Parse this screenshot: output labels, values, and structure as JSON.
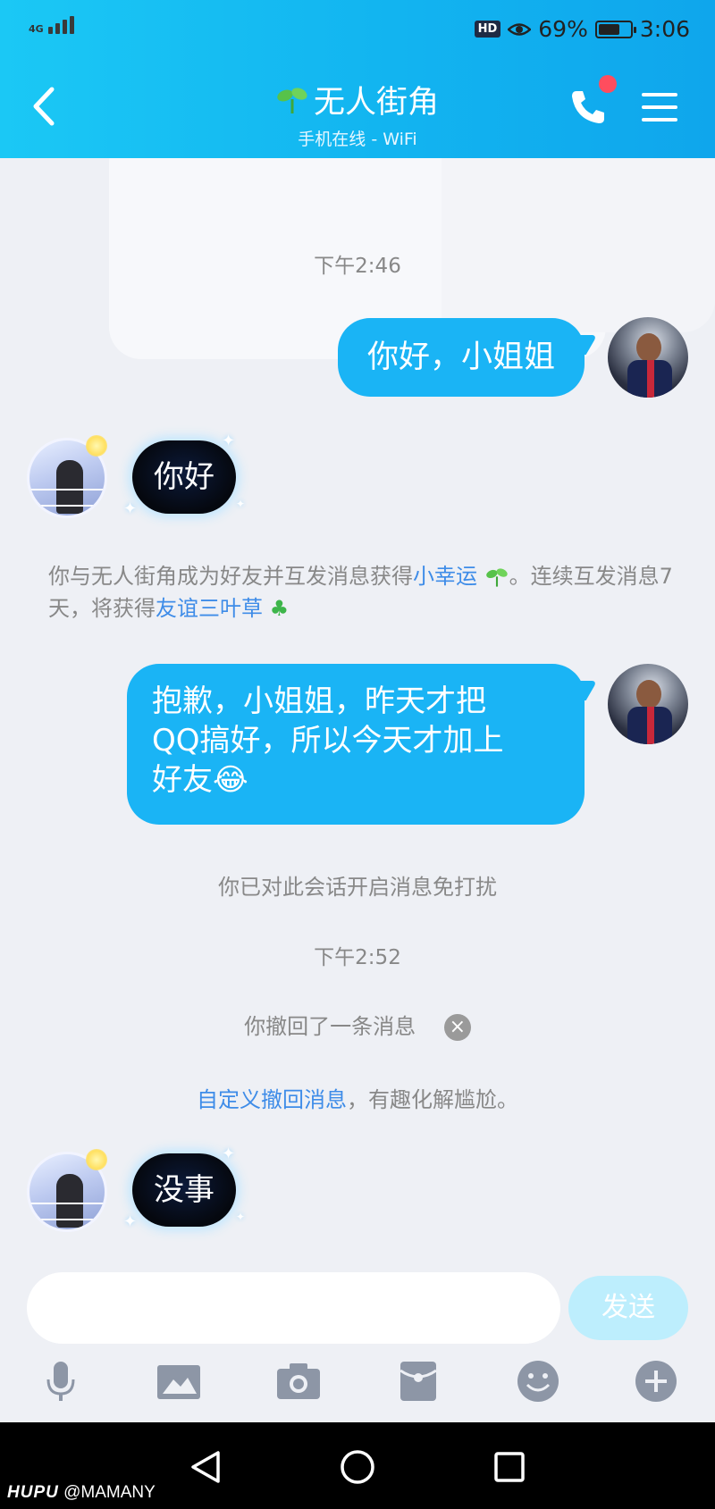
{
  "status_bar": {
    "network": "4G",
    "hd_badge": "HD",
    "battery": "69%",
    "battery_level": 0.69,
    "time": "3:06"
  },
  "header": {
    "title": "无人街角",
    "subtitle": "手机在线 - WiFi",
    "accent_color": "#12b4f0",
    "notification_dot_color": "#ff4d5e"
  },
  "messages": {
    "ts1": "下午2:46",
    "me_msg1": "你好，小姐姐",
    "her_sticker1": "你好",
    "sys1_part1": "你与无人街角成为好友并互发消息获得",
    "sys1_link1": "小幸运",
    "sys1_part2": "。连续互发消息7天，将获得",
    "sys1_link2": "友谊三叶草",
    "me_msg2_line1": "抱歉，小姐姐，昨天才把",
    "me_msg2_line2": "QQ搞好，所以今天才加上",
    "me_msg2_line3": "好友",
    "me_msg2_emoji": "😂",
    "mute_note": "你已对此会话开启消息免打扰",
    "ts2": "下午2:52",
    "recall_note": "你撤回了一条消息",
    "custom_recall_link": "自定义撤回消息",
    "custom_recall_rest": "，有趣化解尴尬。",
    "her_sticker2": "没事"
  },
  "input": {
    "placeholder": "",
    "send_label": "发送"
  },
  "toolbar_icons": [
    "microphone-icon",
    "image-icon",
    "camera-icon",
    "red-packet-icon",
    "emoji-icon",
    "plus-icon"
  ],
  "watermark": {
    "brand": "HUPU",
    "handle": "@MAMANY"
  }
}
